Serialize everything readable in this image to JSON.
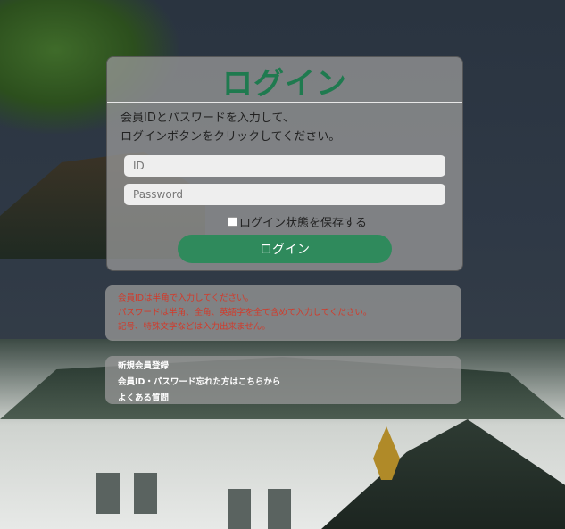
{
  "login": {
    "title": "ログイン",
    "instruction_line1": "会員IDとパスワードを入力して、",
    "instruction_line2": "ログインボタンをクリックしてください。",
    "id_placeholder": "ID",
    "password_placeholder": "Password",
    "remember_label": "ログイン状態を保存する",
    "remember_checked": false,
    "submit_label": "ログイン"
  },
  "notice": {
    "line1": "会員IDは半角で入力してください。",
    "line2": "パスワードは半角、全角、英語字を全て含めて入力してください。",
    "line3": "記号、特殊文字などは入力出来ません。"
  },
  "links": {
    "register": "新規会員登録",
    "forgot": "会員ID・パスワード忘れた方はこちらから",
    "faq": "よくある質問"
  },
  "colors": {
    "accent": "#2f8a5c",
    "title": "#1f7a4f",
    "notice_text": "#d23a2a"
  }
}
